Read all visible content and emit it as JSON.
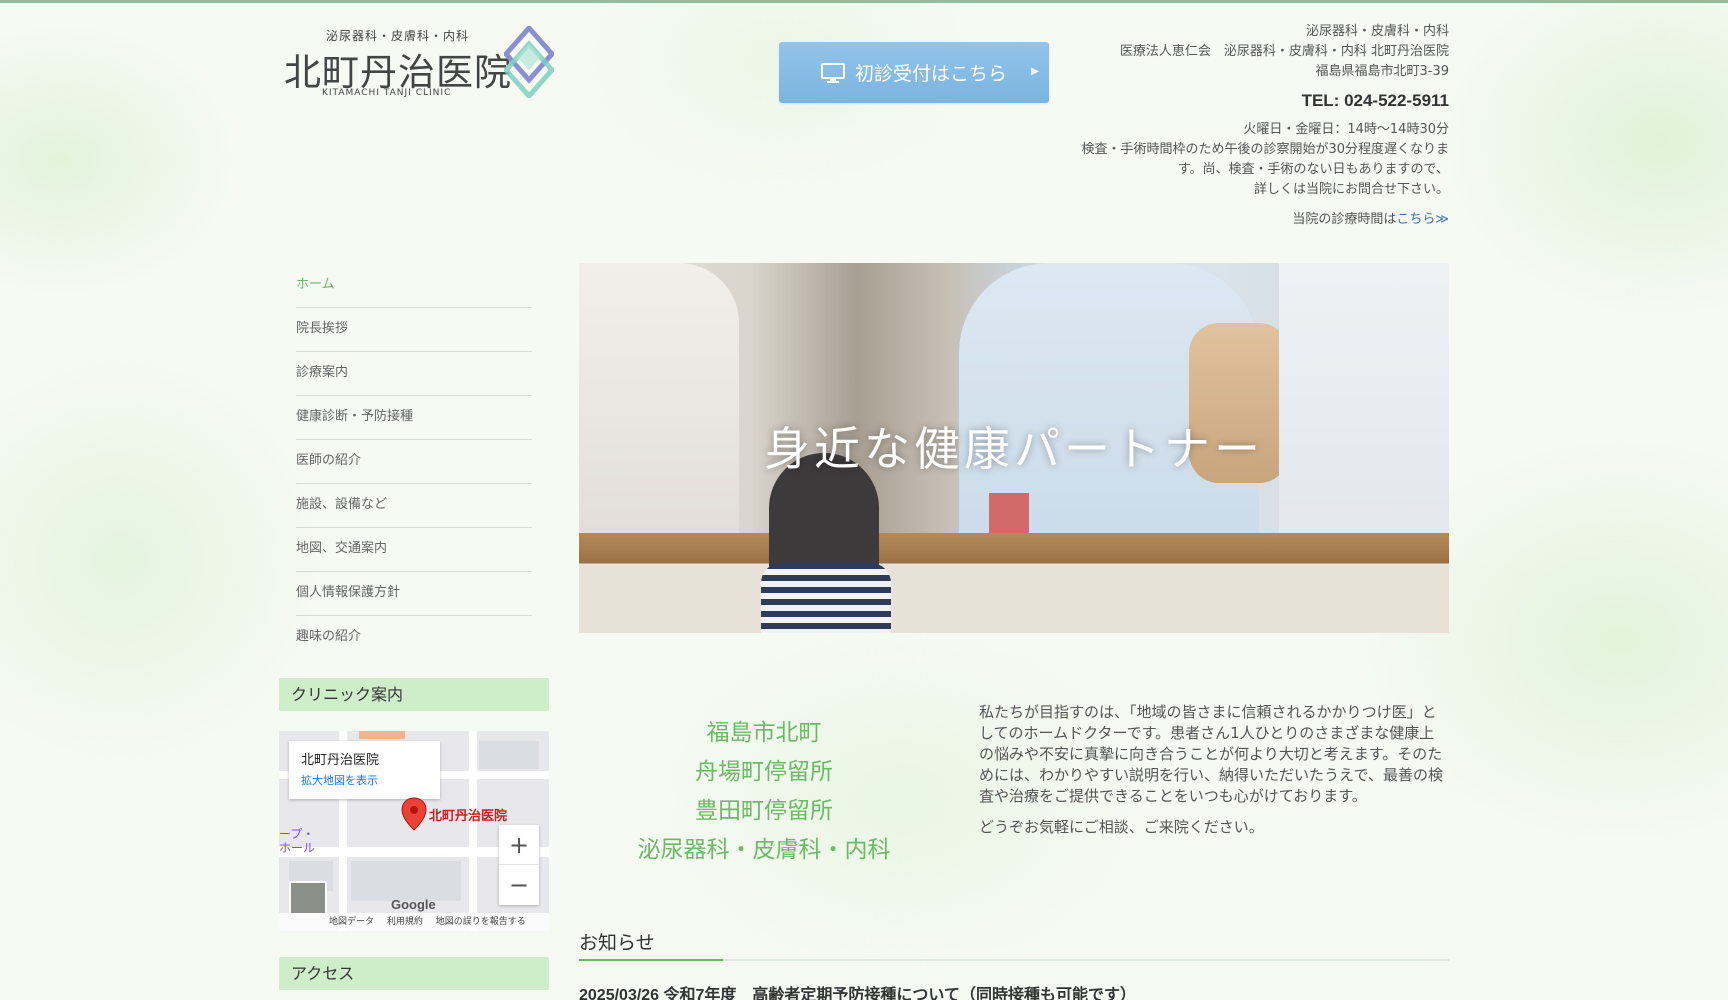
{
  "logo": {
    "subtitle": "泌尿器科・皮膚科・内科",
    "name": "北町丹治医院",
    "english": "KITAMACHI TANJI CLINIC"
  },
  "first_visit_button": {
    "label": "初診受付はこちら",
    "icon": "monitor-icon"
  },
  "header_info": {
    "line1": "泌尿器科・皮膚科・内科",
    "line2": "医療法人恵仁会　泌尿器科・皮膚科・内科 北町丹治医院",
    "line3": "福島県福島市北町3-39",
    "tel": "TEL: 024-522-5911",
    "hours_line1": "火曜日・金曜日：14時～14時30分",
    "hours_line2": "検査・手術時間枠のため午後の診察開始が30分程度遅くなりま",
    "hours_line3": "す。尚、検査・手術のない日もありますので、",
    "hours_line4": "詳しくは当院にお問合せ下さい。",
    "hours_link_prefix": "当院の診療時間は",
    "hours_link_text": "こちら≫"
  },
  "nav": {
    "items": [
      {
        "label": "ホーム"
      },
      {
        "label": "院長挨拶"
      },
      {
        "label": "診療案内"
      },
      {
        "label": "健康診断・予防接種"
      },
      {
        "label": "医師の紹介"
      },
      {
        "label": "施設、設備など"
      },
      {
        "label": "地図、交通案内"
      },
      {
        "label": "個人情報保護方針"
      },
      {
        "label": "趣味の紹介"
      }
    ]
  },
  "sidebar": {
    "clinic_heading": "クリニック案内",
    "access_heading": "アクセス"
  },
  "map": {
    "place_name": "北町丹治医院",
    "enlarge_link": "拡大地図を表示",
    "pin_label": "北町丹治医院",
    "left_label": "ープ・\nホール",
    "google": "Google",
    "footer_data": "地図データ",
    "footer_terms": "利用規約",
    "footer_report": "地図の誤りを報告する",
    "zoom_in": "+",
    "zoom_out": "−"
  },
  "hero": {
    "text": "身近な健康パートナー"
  },
  "locations": [
    "福島市北町",
    "舟場町停留所",
    "豊田町停留所",
    "泌尿器科・皮膚科・内科"
  ],
  "intro": {
    "p1": "私たちが目指すのは、「地域の皆さまに信頼されるかかりつけ医」としてのホームドクターです。患者さん1人ひとりのさまざまな健康上の悩みや不安に真摯に向き合うことが何より大切と考えます。そのためには、わかりやすい説明を行い、納得いただいたうえで、最善の検査や治療をご提供できることをいつも心がけております。",
    "p2": "どうぞお気軽にご相談、ご来院ください。"
  },
  "news": {
    "heading": "お知らせ",
    "items": [
      {
        "text": "2025/03/26  令和7年度　高齢者定期予防接種について（同時接種も可能です）"
      }
    ]
  },
  "colors": {
    "accent_green": "#6cba66",
    "button_blue": "#7bb4e0",
    "link_blue": "#3a6fb0",
    "heading_bg": "#cdeec9"
  }
}
